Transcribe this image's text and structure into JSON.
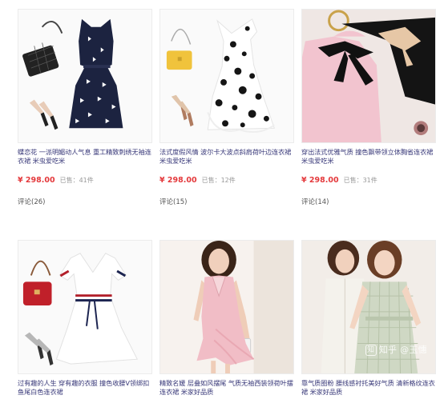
{
  "products": [
    {
      "title": "蝶恋花 一派明媚动人气息 重工精致刺绣无袖连衣裙 米虫爱吃米",
      "price": "¥ 298.00",
      "sold": "已售：41件",
      "reviews_label": "评论",
      "reviews_count": "(26)"
    },
    {
      "title": "法式度假风情 波尔卡大波点斜肩荷叶边连衣裙 米虫爱吃米",
      "price": "¥ 298.00",
      "sold": "已售：12件",
      "reviews_label": "评论",
      "reviews_count": "(15)"
    },
    {
      "title": "穿出法式优雅气质 撞色飘带领立体胸省连衣裙 米虫爱吃米",
      "price": "¥ 298.00",
      "sold": "已售：31件",
      "reviews_label": "评论",
      "reviews_count": "(14)"
    },
    {
      "title": "过有趣的人生 穿有趣的衣服 撞色收腰V领绑扣鱼尾白色连衣裙",
      "price": "",
      "sold": "",
      "reviews_label": "",
      "reviews_count": ""
    },
    {
      "title": "精致名媛 层叠如风摆尾 气质无袖西装领荷叶摆连衣裙 米家好品质",
      "price": "",
      "sold": "",
      "reviews_label": "",
      "reviews_count": ""
    },
    {
      "title": "靠气质圈粉 腰线感衬托美好气质 清新格纹连衣裙 米家好品质",
      "price": "",
      "sold": "",
      "reviews_label": "",
      "reviews_count": ""
    }
  ],
  "watermark": {
    "logo": "知",
    "text": "知乎 @玉憓"
  },
  "colors": {
    "price": "#e4393c",
    "title": "#3a3a7a"
  }
}
